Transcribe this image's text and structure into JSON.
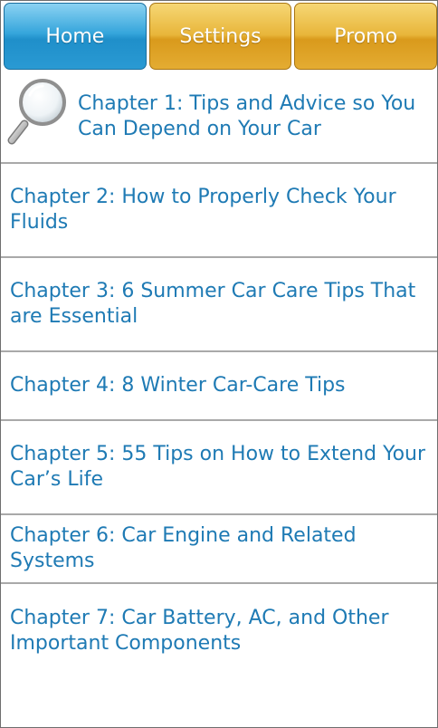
{
  "tabs": [
    {
      "label": "Home",
      "active": true
    },
    {
      "label": "Settings",
      "active": false
    },
    {
      "label": "Promo",
      "active": false
    }
  ],
  "chapters": [
    "Chapter 1: Tips and Advice so You Can Depend on Your Car",
    "Chapter 2: How to Properly Check Your Fluids",
    "Chapter 3: 6 Summer Car Care Tips That are Essential",
    "Chapter 4: 8 Winter Car-Care Tips",
    "Chapter 5: 55 Tips on How to Extend Your Car’s Life",
    "Chapter 6: Car Engine and Related Systems",
    "Chapter 7: Car Battery, AC, and Other Important Components"
  ],
  "icons": {
    "search": "magnifier-icon"
  },
  "colors": {
    "link": "#1e7ab4",
    "tab_active": "#2a9ad3",
    "tab_inactive": "#e4ac32",
    "divider": "#a9a9a9"
  }
}
